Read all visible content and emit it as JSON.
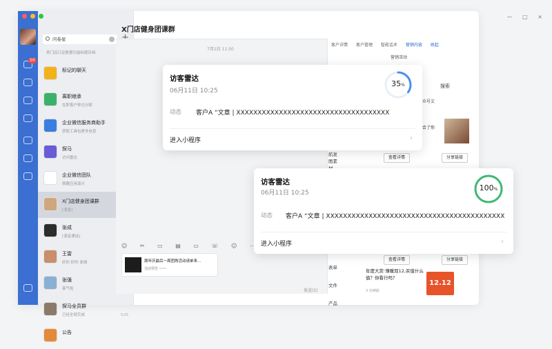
{
  "window": {
    "controls": "— □ ×"
  },
  "sidebar": {
    "badge": "50"
  },
  "conversations": {
    "search_value": "问卷星",
    "tip": "将门店口径数据功能标题存档",
    "items": [
      {
        "name": "标记的聊天",
        "sub": "",
        "time": "",
        "color": "#f3b21c"
      },
      {
        "name": "离职继承",
        "sub": "在职客户移交分配",
        "time": "2分钟前",
        "color": "#3bb16b"
      },
      {
        "name": "企业微信服务商助手",
        "sub": "获取工具包更多信息",
        "time": "昨天",
        "color": "#3b7de0"
      },
      {
        "name": "探马",
        "sub": "访问雷达",
        "time": "昨天",
        "color": "#6a5bd6"
      },
      {
        "name": "企业微信团队",
        "sub": "佩戴应用演示",
        "time": "昨天",
        "color": "#ffffff"
      },
      {
        "name": "X门店健身团课群",
        "sub": "[消息]",
        "time": "",
        "color": "#cfa67d"
      },
      {
        "name": "张成",
        "sub": "[语音通话]",
        "time": "6/2",
        "color": "#2c2c2c"
      },
      {
        "name": "王雷",
        "sub": "好的 好的 谢谢",
        "time": "5/27",
        "color": "#c98e6b"
      },
      {
        "name": "张强",
        "sub": "客气啦",
        "time": "5/27",
        "color": "#8ab0d4"
      },
      {
        "name": "探马全员群",
        "sub": "已经全部完成",
        "time": "5/26",
        "color": "#8b7a6a"
      },
      {
        "name": "公告",
        "sub": "",
        "time": "",
        "color": "#e58a3a"
      }
    ]
  },
  "chat": {
    "title": "X门店健身团课群",
    "time": "7月1日 11:50",
    "toolbar_icons": "☺ ✂ ▭ ▤ ▭ ☏ ☺ ⋯",
    "message": {
      "title": "周年庆最后一周团购活动请单来...",
      "sub": "活动预告 ～～"
    },
    "send_label": "发送(S)"
  },
  "right_panel": {
    "tabs": [
      "客户详情",
      "客户管理",
      "智能话术",
      "营销内容",
      "收起"
    ],
    "subtabs": [
      "营销活动"
    ],
    "search": "搜索",
    "filters": [
      "文章",
      "公众号文"
    ],
    "side_labels": [
      "航发",
      "图素",
      "材",
      "表单",
      "文件",
      "产品"
    ],
    "buttons": [
      "查看详情",
      "分享链接",
      "查看详情",
      "分享链接"
    ],
    "item_text": "合了你",
    "article": {
      "title": "年度大赏·薄暖双12,买值什么值？你看行吗？",
      "sub": "3 分钟前"
    },
    "promo": "12.12"
  },
  "radar_cards": [
    {
      "title": "访客雷达",
      "date": "06月11日 10:25",
      "label": "动态",
      "text": "客户A “文章 | XXXXXXXXXXXXXXXXXXXXXXXXXXXXXXXXXXXX",
      "entry": "进入小程序",
      "percent": "35",
      "color": "#4a8ff0",
      "fraction": 0.35
    },
    {
      "title": "访客雷达",
      "date": "06月11日 10:25",
      "label": "动态",
      "text": "客户A “文章 | XXXXXXXXXXXXXXXXXXXXXXXXXXXXXXXXXXXXXXXXXX",
      "entry": "进入小程序",
      "percent": "100",
      "color": "#3fb873",
      "fraction": 1.0
    }
  ]
}
